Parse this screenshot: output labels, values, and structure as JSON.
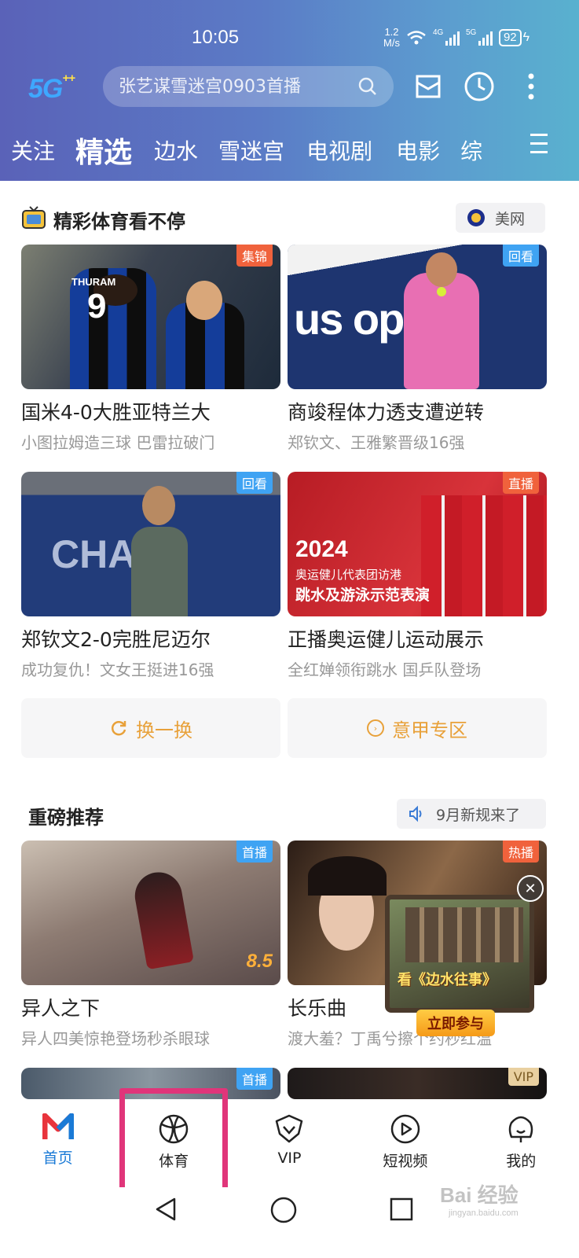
{
  "status_bar": {
    "time": "10:05",
    "speed_value": "1.2",
    "speed_unit": "M/s",
    "net1": "4G",
    "net2": "5G",
    "battery": "92"
  },
  "header": {
    "logo": "5G",
    "logo_super": "++",
    "search_placeholder": "张艺谋雪迷宫0903首播"
  },
  "nav_tabs": [
    "关注",
    "精选",
    "边水",
    "雪迷宫",
    "电视剧",
    "电影",
    "综"
  ],
  "sports_section": {
    "title": "精彩体育看不停",
    "partner": "美网",
    "cards": [
      {
        "badge": "集锦",
        "title": "国米4-0大胜亚特兰大",
        "subtitle": "小图拉姆造三球 巴雷拉破门",
        "jersey_name": "THURAM",
        "jersey_number": "9"
      },
      {
        "badge": "回看",
        "title": "商竣程体力透支遭逆转",
        "subtitle": "郑钦文、王雅繁晋级16强",
        "banner_text": "us open"
      },
      {
        "badge": "回看",
        "title": "郑钦文2-0完胜尼迈尔",
        "subtitle": "成功复仇！文女王挺进16强",
        "banner_text": "CHAS"
      },
      {
        "badge": "直播",
        "title": "正播奥运健儿运动展示",
        "subtitle": "全红婵领衔跳水 国乒队登场",
        "poster_year": "2024",
        "poster_line1": "奥运健儿代表团访港",
        "poster_line2": "跳水及游泳示范表演"
      }
    ],
    "buttons": [
      "换一换",
      "意甲专区"
    ]
  },
  "featured_section": {
    "title": "重磅推荐",
    "notice": "9月新规来了",
    "cards": [
      {
        "badge": "首播",
        "title": "异人之下",
        "subtitle": "异人四美惊艳登场秒杀眼球",
        "score": "8.5"
      },
      {
        "badge": "热播",
        "title": "长乐曲",
        "subtitle": "渡大羞？丁禹兮擦个约秒红温"
      },
      {
        "badge": "首播"
      },
      {
        "badge": "VIP"
      }
    ]
  },
  "floating_ad": {
    "headline": "看《边水往事》",
    "cta": "立即参与"
  },
  "bottom_nav": [
    {
      "label": "首页",
      "icon": "home-logo-icon"
    },
    {
      "label": "体育",
      "icon": "basketball-icon"
    },
    {
      "label": "VIP",
      "icon": "vip-shield-icon"
    },
    {
      "label": "短视频",
      "icon": "play-circle-icon"
    },
    {
      "label": "我的",
      "icon": "profile-icon"
    }
  ],
  "watermark": {
    "line1": "Bai 经验",
    "line2": "jingyan.baidu.com"
  },
  "colors": {
    "accent_blue": "#1a7ad6",
    "badge_blue": "#3fa3f3",
    "badge_orange": "#f0623c",
    "button_orange": "#e8a13a",
    "highlight": "#e0357a"
  }
}
